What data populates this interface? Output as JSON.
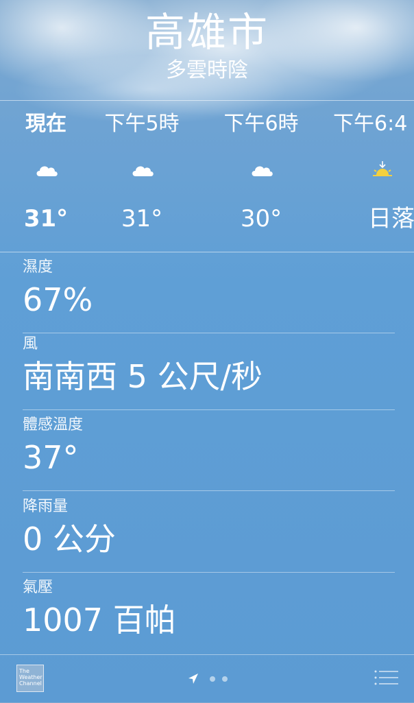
{
  "header": {
    "city": "高雄市",
    "condition": "多雲時陰"
  },
  "hourly": [
    {
      "time": "現在",
      "icon": "cloud-icon",
      "temp": "31°",
      "bold": true
    },
    {
      "time": "下午5時",
      "icon": "cloud-icon",
      "temp": "31°",
      "bold": false
    },
    {
      "time": "下午6時",
      "icon": "cloud-icon",
      "temp": "30°",
      "bold": false
    },
    {
      "time": "下午6:4",
      "icon": "sunset-icon",
      "temp": "日落",
      "bold": false
    }
  ],
  "details": [
    {
      "label": "濕度",
      "value": "67%"
    },
    {
      "label": "風",
      "value": "南南西 5 公尺/秒"
    },
    {
      "label": "體感溫度",
      "value": "37°"
    },
    {
      "label": "降雨量",
      "value": "0 公分"
    },
    {
      "label": "氣壓",
      "value": "1007 百帕"
    }
  ],
  "bottom_bar": {
    "logo_text": "The Weather Channel",
    "location_icon": "location-arrow-icon",
    "list_icon": "list-icon"
  },
  "colors": {
    "sunset": "#f4d03f"
  }
}
